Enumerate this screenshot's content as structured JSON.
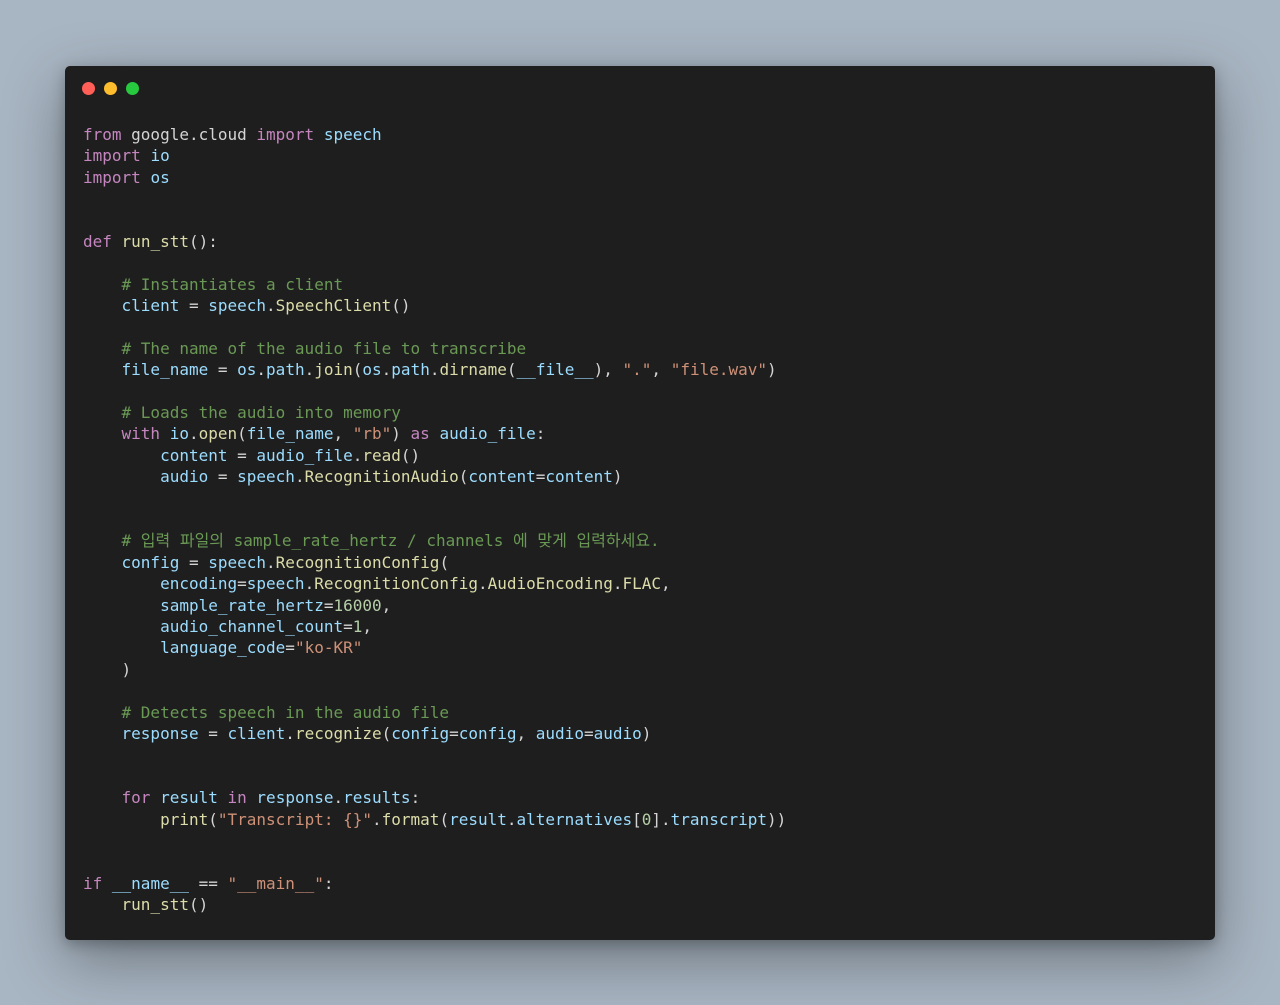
{
  "window": {
    "buttons": [
      {
        "name": "close",
        "color": "#ff5f56"
      },
      {
        "name": "minimize",
        "color": "#ffbd2e"
      },
      {
        "name": "maximize",
        "color": "#27c93f"
      }
    ]
  },
  "theme": {
    "kw": "#c586c0",
    "fn": "#dcdcaa",
    "var": "#9cdcfe",
    "str": "#ce9178",
    "num": "#b5cea8",
    "com": "#6a9955",
    "pl": "#d4d4d4"
  },
  "code": {
    "lines": [
      [
        [
          "kw",
          "from"
        ],
        [
          "pl",
          " google.cloud "
        ],
        [
          "kw",
          "import"
        ],
        [
          "pl",
          " "
        ],
        [
          "var",
          "speech"
        ]
      ],
      [
        [
          "kw",
          "import"
        ],
        [
          "pl",
          " "
        ],
        [
          "var",
          "io"
        ]
      ],
      [
        [
          "kw",
          "import"
        ],
        [
          "pl",
          " "
        ],
        [
          "var",
          "os"
        ]
      ],
      [],
      [],
      [
        [
          "kw",
          "def"
        ],
        [
          "pl",
          " "
        ],
        [
          "fn",
          "run_stt"
        ],
        [
          "pl",
          "():"
        ]
      ],
      [],
      [
        [
          "pl",
          "    "
        ],
        [
          "com",
          "# Instantiates a client"
        ]
      ],
      [
        [
          "pl",
          "    "
        ],
        [
          "var",
          "client"
        ],
        [
          "pl",
          " = "
        ],
        [
          "var",
          "speech"
        ],
        [
          "pl",
          "."
        ],
        [
          "fn",
          "SpeechClient"
        ],
        [
          "pl",
          "()"
        ]
      ],
      [],
      [
        [
          "pl",
          "    "
        ],
        [
          "com",
          "# The name of the audio file to transcribe"
        ]
      ],
      [
        [
          "pl",
          "    "
        ],
        [
          "var",
          "file_name"
        ],
        [
          "pl",
          " = "
        ],
        [
          "var",
          "os"
        ],
        [
          "pl",
          "."
        ],
        [
          "var",
          "path"
        ],
        [
          "pl",
          "."
        ],
        [
          "fn",
          "join"
        ],
        [
          "pl",
          "("
        ],
        [
          "var",
          "os"
        ],
        [
          "pl",
          "."
        ],
        [
          "var",
          "path"
        ],
        [
          "pl",
          "."
        ],
        [
          "fn",
          "dirname"
        ],
        [
          "pl",
          "("
        ],
        [
          "var",
          "__file__"
        ],
        [
          "pl",
          "), "
        ],
        [
          "str",
          "\".\""
        ],
        [
          "pl",
          ", "
        ],
        [
          "str",
          "\"file.wav\""
        ],
        [
          "pl",
          ")"
        ]
      ],
      [],
      [
        [
          "pl",
          "    "
        ],
        [
          "com",
          "# Loads the audio into memory"
        ]
      ],
      [
        [
          "pl",
          "    "
        ],
        [
          "kw",
          "with"
        ],
        [
          "pl",
          " "
        ],
        [
          "var",
          "io"
        ],
        [
          "pl",
          "."
        ],
        [
          "fn",
          "open"
        ],
        [
          "pl",
          "("
        ],
        [
          "var",
          "file_name"
        ],
        [
          "pl",
          ", "
        ],
        [
          "str",
          "\"rb\""
        ],
        [
          "pl",
          ") "
        ],
        [
          "kw",
          "as"
        ],
        [
          "pl",
          " "
        ],
        [
          "var",
          "audio_file"
        ],
        [
          "pl",
          ":"
        ]
      ],
      [
        [
          "pl",
          "        "
        ],
        [
          "var",
          "content"
        ],
        [
          "pl",
          " = "
        ],
        [
          "var",
          "audio_file"
        ],
        [
          "pl",
          "."
        ],
        [
          "fn",
          "read"
        ],
        [
          "pl",
          "()"
        ]
      ],
      [
        [
          "pl",
          "        "
        ],
        [
          "var",
          "audio"
        ],
        [
          "pl",
          " = "
        ],
        [
          "var",
          "speech"
        ],
        [
          "pl",
          "."
        ],
        [
          "fn",
          "RecognitionAudio"
        ],
        [
          "pl",
          "("
        ],
        [
          "var",
          "content"
        ],
        [
          "pl",
          "="
        ],
        [
          "var",
          "content"
        ],
        [
          "pl",
          ")"
        ]
      ],
      [],
      [],
      [
        [
          "pl",
          "    "
        ],
        [
          "com",
          "# 입력 파일의 sample_rate_hertz / channels 에 맞게 입력하세요."
        ]
      ],
      [
        [
          "pl",
          "    "
        ],
        [
          "var",
          "config"
        ],
        [
          "pl",
          " = "
        ],
        [
          "var",
          "speech"
        ],
        [
          "pl",
          "."
        ],
        [
          "fn",
          "RecognitionConfig"
        ],
        [
          "pl",
          "("
        ]
      ],
      [
        [
          "pl",
          "        "
        ],
        [
          "var",
          "encoding"
        ],
        [
          "pl",
          "="
        ],
        [
          "var",
          "speech"
        ],
        [
          "pl",
          "."
        ],
        [
          "fn",
          "RecognitionConfig"
        ],
        [
          "pl",
          "."
        ],
        [
          "fn",
          "AudioEncoding"
        ],
        [
          "pl",
          "."
        ],
        [
          "fn",
          "FLAC"
        ],
        [
          "pl",
          ","
        ]
      ],
      [
        [
          "pl",
          "        "
        ],
        [
          "var",
          "sample_rate_hertz"
        ],
        [
          "pl",
          "="
        ],
        [
          "num",
          "16000"
        ],
        [
          "pl",
          ","
        ]
      ],
      [
        [
          "pl",
          "        "
        ],
        [
          "var",
          "audio_channel_count"
        ],
        [
          "pl",
          "="
        ],
        [
          "num",
          "1"
        ],
        [
          "pl",
          ","
        ]
      ],
      [
        [
          "pl",
          "        "
        ],
        [
          "var",
          "language_code"
        ],
        [
          "pl",
          "="
        ],
        [
          "str",
          "\"ko-KR\""
        ]
      ],
      [
        [
          "pl",
          "    )"
        ]
      ],
      [],
      [
        [
          "pl",
          "    "
        ],
        [
          "com",
          "# Detects speech in the audio file"
        ]
      ],
      [
        [
          "pl",
          "    "
        ],
        [
          "var",
          "response"
        ],
        [
          "pl",
          " = "
        ],
        [
          "var",
          "client"
        ],
        [
          "pl",
          "."
        ],
        [
          "fn",
          "recognize"
        ],
        [
          "pl",
          "("
        ],
        [
          "var",
          "config"
        ],
        [
          "pl",
          "="
        ],
        [
          "var",
          "config"
        ],
        [
          "pl",
          ", "
        ],
        [
          "var",
          "audio"
        ],
        [
          "pl",
          "="
        ],
        [
          "var",
          "audio"
        ],
        [
          "pl",
          ")"
        ]
      ],
      [],
      [],
      [
        [
          "pl",
          "    "
        ],
        [
          "kw",
          "for"
        ],
        [
          "pl",
          " "
        ],
        [
          "var",
          "result"
        ],
        [
          "pl",
          " "
        ],
        [
          "kw",
          "in"
        ],
        [
          "pl",
          " "
        ],
        [
          "var",
          "response"
        ],
        [
          "pl",
          "."
        ],
        [
          "var",
          "results"
        ],
        [
          "pl",
          ":"
        ]
      ],
      [
        [
          "pl",
          "        "
        ],
        [
          "fn",
          "print"
        ],
        [
          "pl",
          "("
        ],
        [
          "str",
          "\"Transcript: {}\""
        ],
        [
          "pl",
          "."
        ],
        [
          "fn",
          "format"
        ],
        [
          "pl",
          "("
        ],
        [
          "var",
          "result"
        ],
        [
          "pl",
          "."
        ],
        [
          "var",
          "alternatives"
        ],
        [
          "pl",
          "["
        ],
        [
          "num",
          "0"
        ],
        [
          "pl",
          "]."
        ],
        [
          "var",
          "transcript"
        ],
        [
          "pl",
          "))"
        ]
      ],
      [],
      [],
      [
        [
          "kw",
          "if"
        ],
        [
          "pl",
          " "
        ],
        [
          "var",
          "__name__"
        ],
        [
          "pl",
          " == "
        ],
        [
          "str",
          "\"__main__\""
        ],
        [
          "pl",
          ":"
        ]
      ],
      [
        [
          "pl",
          "    "
        ],
        [
          "fn",
          "run_stt"
        ],
        [
          "pl",
          "()"
        ]
      ]
    ]
  }
}
